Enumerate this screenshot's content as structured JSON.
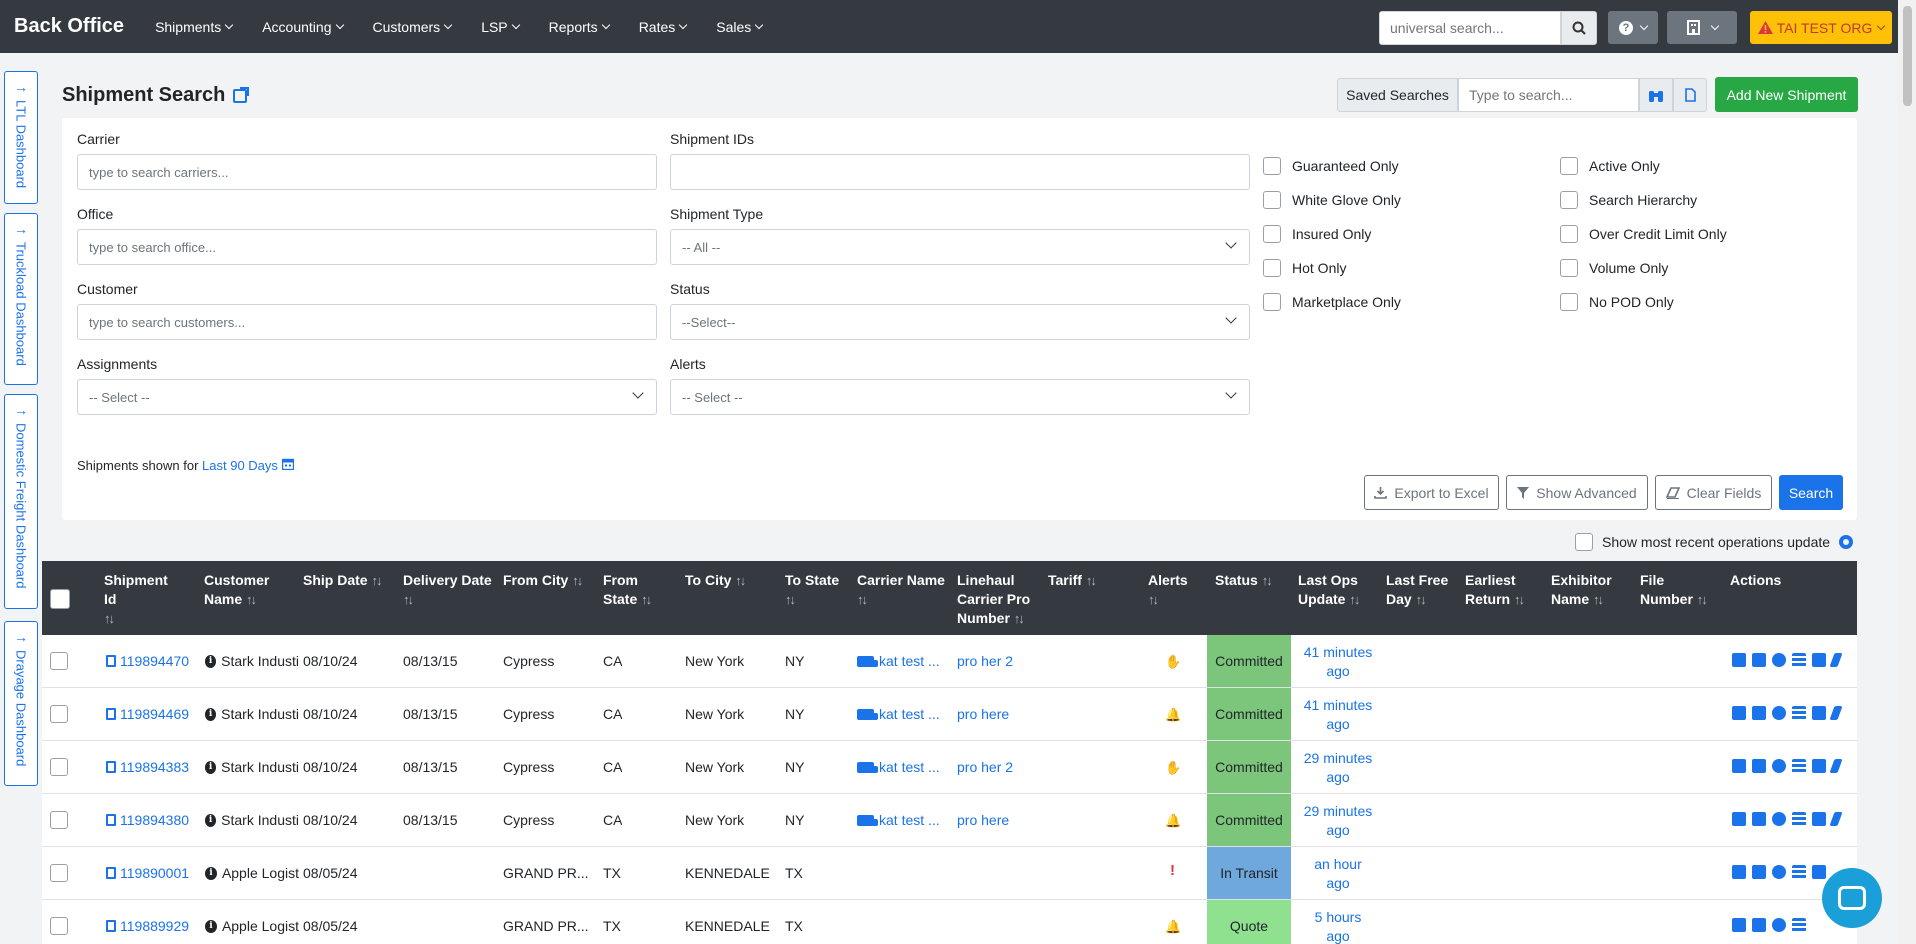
{
  "nav": {
    "brand": "Back Office",
    "items": [
      "Shipments",
      "Accounting",
      "Customers",
      "LSP",
      "Reports",
      "Rates",
      "Sales"
    ],
    "search_placeholder": "universal search...",
    "org": "TAI TEST ORG"
  },
  "sidetabs": [
    "LTL Dashboard",
    "Truckload Dashboard",
    "Domestic Freight Dashboard",
    "Drayage Dashboard"
  ],
  "page": {
    "title": "Shipment Search",
    "saved_searches": "Saved Searches",
    "saved_placeholder": "Type to search...",
    "add_button": "Add New Shipment"
  },
  "filters": {
    "carrier_label": "Carrier",
    "carrier_placeholder": "type to search carriers...",
    "office_label": "Office",
    "office_placeholder": "type to search office...",
    "customer_label": "Customer",
    "customer_placeholder": "type to search customers...",
    "assignments_label": "Assignments",
    "assignments_value": "-- Select --",
    "shipment_ids_label": "Shipment IDs",
    "shipment_type_label": "Shipment Type",
    "shipment_type_value": "-- All --",
    "status_label": "Status",
    "status_value": "--Select--",
    "alerts_label": "Alerts",
    "alerts_value": "-- Select --",
    "checkboxes_left": [
      "Guaranteed Only",
      "White Glove Only",
      "Insured Only",
      "Hot Only",
      "Marketplace Only"
    ],
    "checkboxes_right": [
      "Active Only",
      "Search Hierarchy",
      "Over Credit Limit Only",
      "Volume Only",
      "No POD Only"
    ],
    "shown_for_prefix": "Shipments shown for",
    "shown_for_range": "Last 90 Days",
    "export": "Export to Excel",
    "advanced": "Show Advanced",
    "clear": "Clear Fields",
    "search": "Search",
    "recent_ops": "Show most recent operations update"
  },
  "table": {
    "headers": {
      "shipment_id": "Shipment Id",
      "customer_name": "Customer Name",
      "ship_date": "Ship Date",
      "delivery_date": "Delivery Date",
      "from_city": "From City",
      "from_state": "From State",
      "to_city": "To City",
      "to_state": "To State",
      "carrier_name": "Carrier Name",
      "linehaul": "Linehaul Carrier Pro Number",
      "tariff": "Tariff",
      "alerts": "Alerts",
      "status": "Status",
      "last_ops": "Last Ops Update",
      "last_free": "Last Free Day",
      "earliest_return": "Earliest Return",
      "exhibitor": "Exhibitor Name",
      "file_number": "File Number",
      "actions": "Actions"
    },
    "rows": [
      {
        "id": "119894470",
        "customer": "Stark Industi",
        "ship": "08/10/24",
        "delivery": "08/13/15",
        "from_city": "Cypress",
        "from_state": "CA",
        "to_city": "New York",
        "to_state": "NY",
        "carrier": "kat test ...",
        "pro": "pro her 2",
        "alert": "hand",
        "status": "Committed",
        "status_color": "#7bc67b",
        "ops1": "41 minutes",
        "ops2": "ago"
      },
      {
        "id": "119894469",
        "customer": "Stark Industi",
        "ship": "08/10/24",
        "delivery": "08/13/15",
        "from_city": "Cypress",
        "from_state": "CA",
        "to_city": "New York",
        "to_state": "NY",
        "carrier": "kat test ...",
        "pro": "pro here",
        "alert": "bell",
        "status": "Committed",
        "status_color": "#7bc67b",
        "ops1": "41 minutes",
        "ops2": "ago"
      },
      {
        "id": "119894383",
        "customer": "Stark Industi",
        "ship": "08/10/24",
        "delivery": "08/13/15",
        "from_city": "Cypress",
        "from_state": "CA",
        "to_city": "New York",
        "to_state": "NY",
        "carrier": "kat test ...",
        "pro": "pro her 2",
        "alert": "hand",
        "status": "Committed",
        "status_color": "#7bc67b",
        "ops1": "29 minutes",
        "ops2": "ago"
      },
      {
        "id": "119894380",
        "customer": "Stark Industi",
        "ship": "08/10/24",
        "delivery": "08/13/15",
        "from_city": "Cypress",
        "from_state": "CA",
        "to_city": "New York",
        "to_state": "NY",
        "carrier": "kat test ...",
        "pro": "pro here",
        "alert": "bell",
        "status": "Committed",
        "status_color": "#7bc67b",
        "ops1": "29 minutes",
        "ops2": "ago"
      },
      {
        "id": "119890001",
        "customer": "Apple Logist",
        "ship": "08/05/24",
        "delivery": "",
        "from_city": "GRAND PR...",
        "from_state": "TX",
        "to_city": "KENNEDALE",
        "to_state": "TX",
        "carrier": "",
        "pro": "",
        "alert": "!",
        "status": "In Transit",
        "status_color": "#6fa8dc",
        "ops1": "an hour",
        "ops2": "ago"
      },
      {
        "id": "119889929",
        "customer": "Apple Logist",
        "ship": "08/05/24",
        "delivery": "",
        "from_city": "GRAND PR...",
        "from_state": "TX",
        "to_city": "KENNEDALE",
        "to_state": "TX",
        "carrier": "",
        "pro": "",
        "alert": "bell",
        "status": "Quote",
        "status_color": "#8fe08f",
        "ops1": "5 hours",
        "ops2": "ago"
      }
    ]
  },
  "icons": {
    "search": "search-icon",
    "help": "help-icon",
    "building": "building-icon",
    "warning": "warning-icon",
    "calendar": "calendar-icon",
    "gear": "gear-icon",
    "chat": "chat-icon"
  },
  "colors": {
    "nav_bg": "#343a40",
    "accent": "#1a73e8",
    "add_green": "#28a745",
    "org_yellow": "#ffc107"
  }
}
